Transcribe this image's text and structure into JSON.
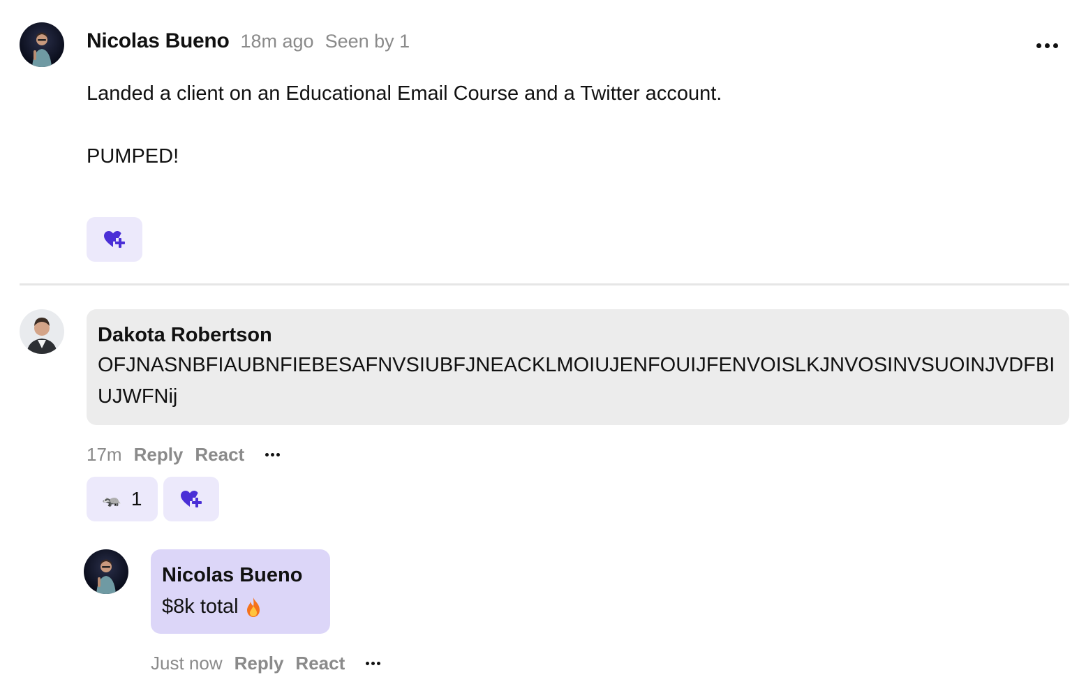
{
  "post": {
    "author": "Nicolas Bueno",
    "time": "18m ago",
    "seen_by": "Seen by 1",
    "paragraph_1": "Landed a client on an Educational Email Course and a Twitter account.",
    "paragraph_2": "PUMPED!"
  },
  "comments": [
    {
      "author": "Dakota Robertson",
      "text": "OFJNASNBFIAUBNFIEBESAFNVSIUBFJNEACKLMOIUJENFOUIJFENVOISLKJNVOSINVSUOINJVDFBIUJWFNij",
      "time": "17m",
      "reply_label": "Reply",
      "react_label": "React",
      "reaction": {
        "emoji": "🦡",
        "count": "1"
      }
    }
  ],
  "reply": {
    "author": "Nicolas Bueno",
    "text": "$8k total",
    "time": "Just now",
    "reply_label": "Reply",
    "react_label": "React"
  },
  "icons": {
    "more": "more-horizontal-icon",
    "add_reaction": "heart-plus-icon",
    "fire": "fire-icon"
  },
  "colors": {
    "accent": "#4a2fd6",
    "reaction_bg": "#ece9fb",
    "own_bubble_bg": "#dcd6f8",
    "other_bubble_bg": "#ececec",
    "muted_text": "#8a8a8a"
  }
}
